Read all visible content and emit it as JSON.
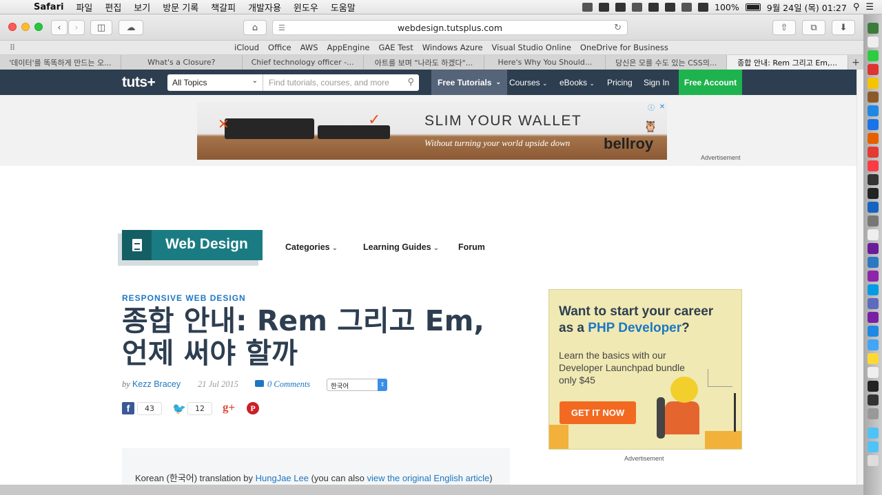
{
  "menubar": {
    "app": "Safari",
    "items": [
      "파일",
      "편집",
      "보기",
      "방문 기록",
      "책갈피",
      "개발자용",
      "윈도우",
      "도움말"
    ],
    "battery": "100%",
    "datetime": "9월 24일 (목) 01:27"
  },
  "toolbar": {
    "address": "webdesign.tutsplus.com"
  },
  "favorites": [
    "iCloud",
    "Office",
    "AWS",
    "AppEngine",
    "GAE Test",
    "Windows Azure",
    "Visual Studio Online",
    "OneDrive for Business"
  ],
  "tabs": [
    "'데이터'를 똑똑하게 만드는 오...",
    "What's a Closure?",
    "Chief technology officer -...",
    "아트를 보며 \"나라도 하겠다\"...",
    "Here's Why You Should...",
    "당신은 모를 수도 있는 CSS의...",
    "종합 안내: Rem 그리고 Em,..."
  ],
  "sitenav": {
    "logo": "tuts+",
    "topic": "All Topics",
    "search_placeholder": "Find tutorials, courses, and more",
    "free_tutorials": "Free Tutorials",
    "courses": "Courses",
    "ebooks": "eBooks",
    "pricing": "Pricing",
    "signin": "Sign In",
    "free_account": "Free Account"
  },
  "banner_ad": {
    "title": "SLIM YOUR WALLET",
    "subtitle": "Without turning your world upside down",
    "brand": "bellroy",
    "label": "Advertisement"
  },
  "section": {
    "name": "Web Design",
    "nav": [
      "Categories",
      "Learning Guides",
      "Forum"
    ]
  },
  "article": {
    "kicker": "RESPONSIVE WEB DESIGN",
    "title": "종합 안내: Rem 그리고 Em, 언제 써야 할까",
    "by": "by",
    "author": "Kezz Bracey",
    "date": "21 Jul 2015",
    "comments": "0 Comments",
    "language": "한국어",
    "facebook_count": "43",
    "twitter_count": "12",
    "note_prefix": "Korean (한국어) translation by ",
    "translator": "HungJae Lee",
    "note_middle": " (you can also ",
    "original_link": "view the original English article",
    "note_suffix": ")"
  },
  "side_ad": {
    "headline_1": "Want to start your career",
    "headline_2a": "as a ",
    "headline_accent": "PHP Developer",
    "headline_2b": "?",
    "body": "Learn the basics with our Developer Launchpad bundle only $45",
    "cta": "GET IT NOW",
    "label": "Advertisement"
  }
}
